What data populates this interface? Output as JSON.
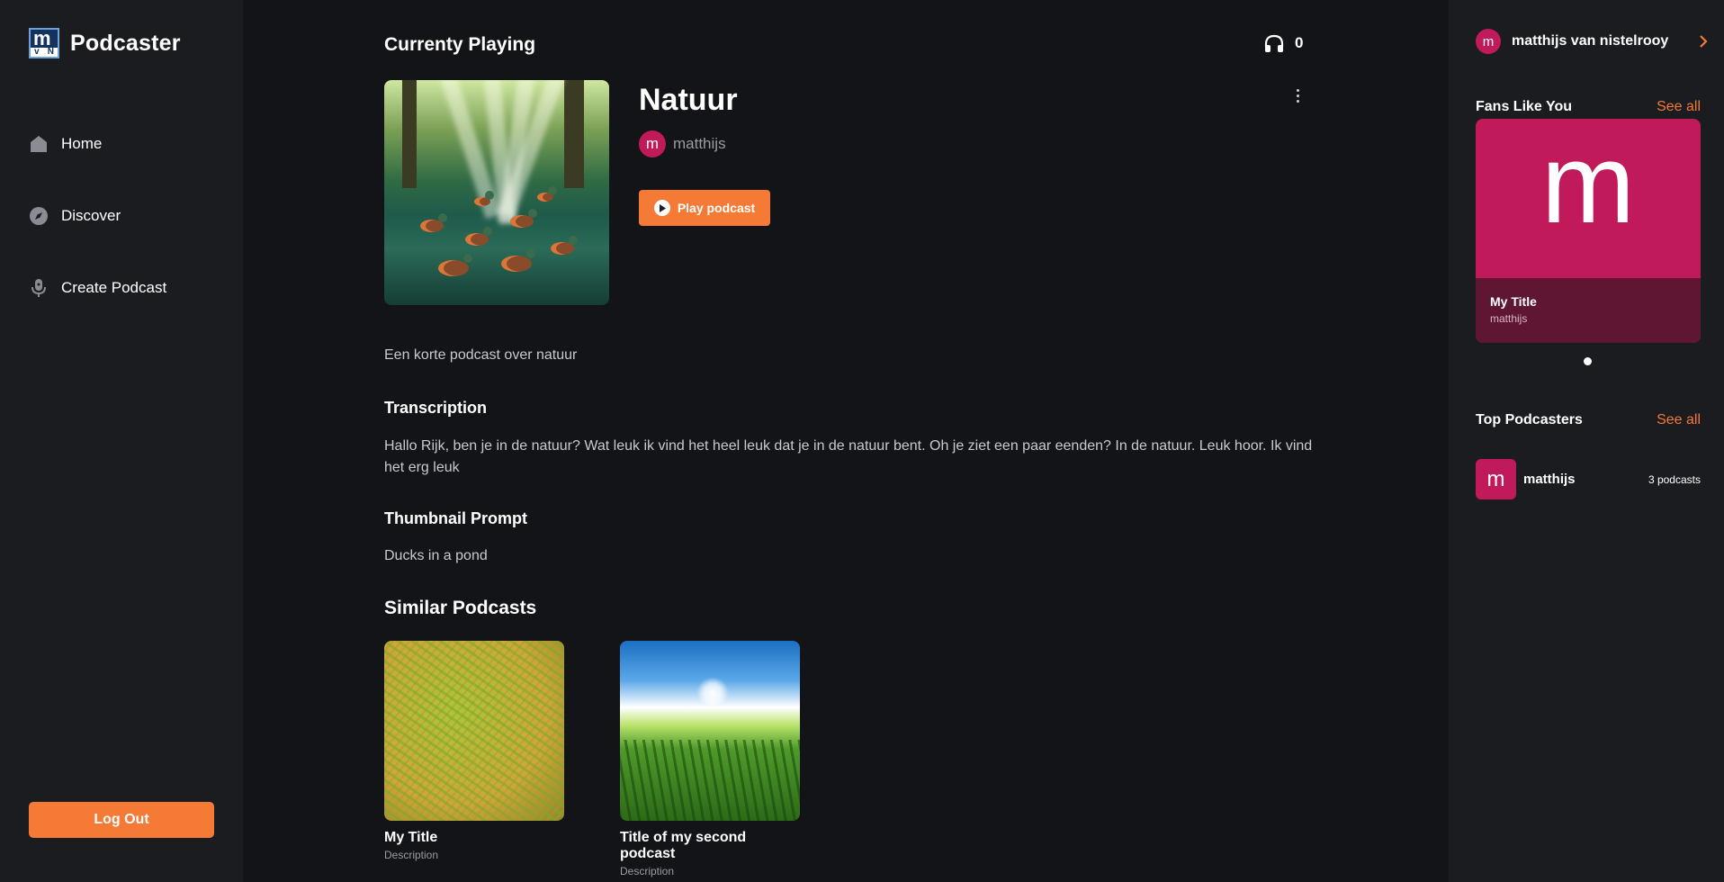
{
  "app": {
    "name": "Podcaster",
    "logo_text": {
      "main": "m",
      "left": "v",
      "right": "N"
    }
  },
  "sidebar": {
    "items": [
      {
        "label": "Home",
        "icon": "home-icon"
      },
      {
        "label": "Discover",
        "icon": "compass-icon"
      },
      {
        "label": "Create Podcast",
        "icon": "microphone-icon"
      }
    ],
    "logout_label": "Log Out"
  },
  "main": {
    "heading": "Currenty Playing",
    "listen_count": "0",
    "podcast": {
      "title": "Natuur",
      "author_initial": "m",
      "author": "matthijs",
      "play_label": "Play podcast",
      "description": "Een korte podcast over natuur"
    },
    "transcription": {
      "heading": "Transcription",
      "text": "Hallo Rijk, ben je in de natuur? Wat leuk ik vind het heel leuk dat je in de natuur bent. Oh je ziet een paar eenden? In de natuur. Leuk hoor. Ik vind het erg leuk"
    },
    "thumbnail_prompt": {
      "heading": "Thumbnail Prompt",
      "text": "Ducks in a pond"
    },
    "similar": {
      "heading": "Similar Podcasts",
      "items": [
        {
          "title": "My Title",
          "description": "Description"
        },
        {
          "title": "Title of my second podcast",
          "description": "Description"
        }
      ]
    }
  },
  "right_panel": {
    "user": {
      "initial": "m",
      "name": "matthijs van nistelrooy"
    },
    "fans": {
      "heading": "Fans Like You",
      "see_all": "See all",
      "card": {
        "letter": "m",
        "title": "My Title",
        "author": "matthijs"
      }
    },
    "top_podcasters": {
      "heading": "Top Podcasters",
      "see_all": "See all",
      "items": [
        {
          "initial": "m",
          "name": "matthijs",
          "count": "3 podcasts"
        }
      ]
    }
  },
  "colors": {
    "accent": "#f47a35",
    "avatar": "#c01a5b",
    "bg": "#131418",
    "panel": "#1b1c20"
  }
}
